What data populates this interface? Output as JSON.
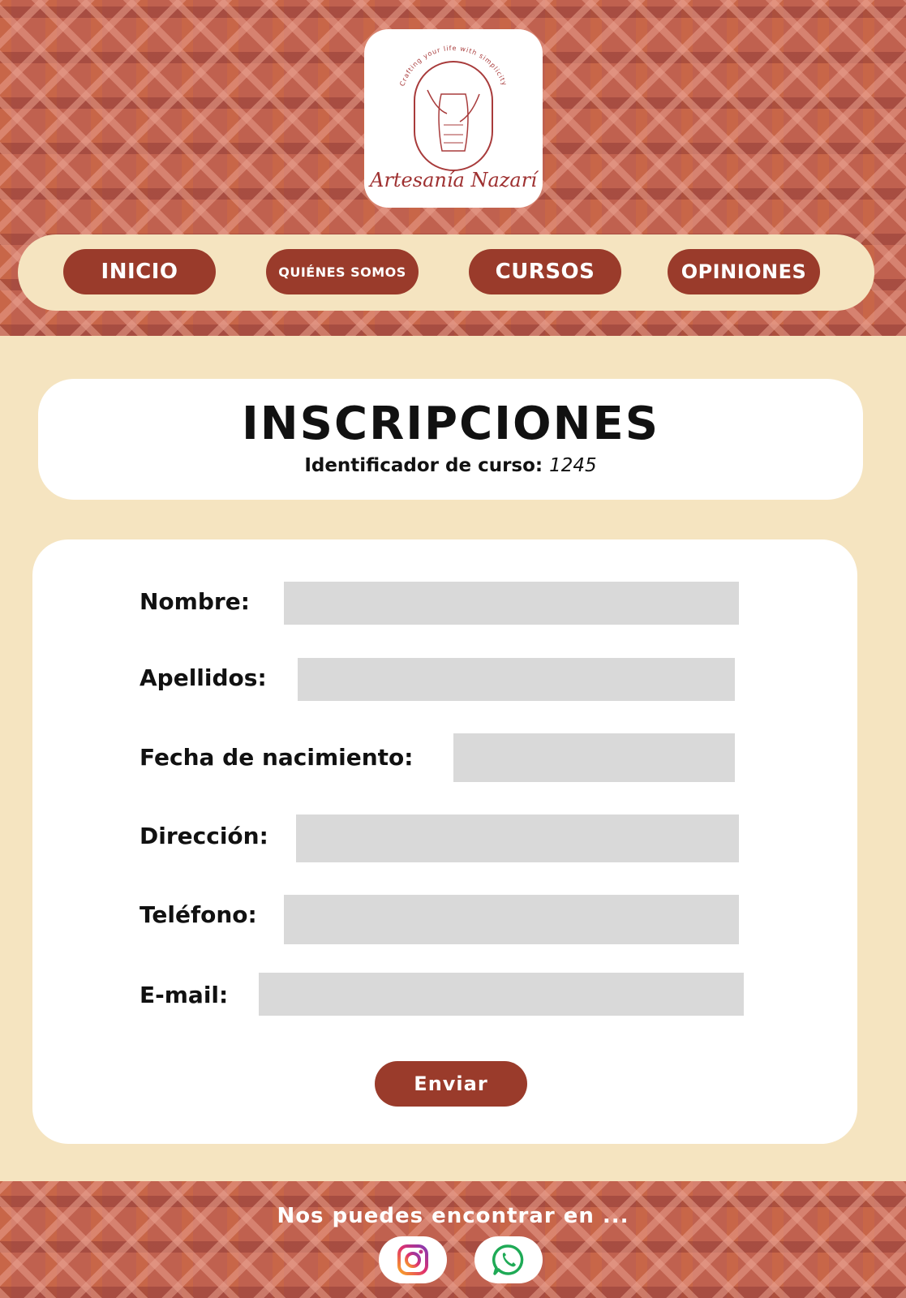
{
  "brand": {
    "name": "Artesanía Nazarí",
    "tagline": "Crafting your life with simplicity",
    "color": "#9e3030"
  },
  "nav": {
    "items": [
      {
        "label": "INICIO"
      },
      {
        "label": "QUIÉNES SOMOS"
      },
      {
        "label": "CURSOS"
      },
      {
        "label": "OPINIONES"
      }
    ]
  },
  "header": {
    "title": "INSCRIPCIONES",
    "course_label": "Identificador de curso:",
    "course_id": "1245"
  },
  "form": {
    "fields": [
      {
        "label": "Nombre:",
        "value": ""
      },
      {
        "label": "Apellidos:",
        "value": ""
      },
      {
        "label": "Fecha de nacimiento:",
        "value": ""
      },
      {
        "label": "Dirección:",
        "value": ""
      },
      {
        "label": "Teléfono:",
        "value": ""
      },
      {
        "label": "E-mail:",
        "value": ""
      }
    ],
    "submit_label": "Enviar"
  },
  "footer": {
    "text": "Nos puedes encontrar en ...",
    "social": [
      {
        "icon": "instagram-icon"
      },
      {
        "icon": "whatsapp-icon"
      }
    ]
  },
  "colors": {
    "accent": "#9a3b2b",
    "background": "#f5e4c0",
    "input": "#d9d9d9"
  }
}
